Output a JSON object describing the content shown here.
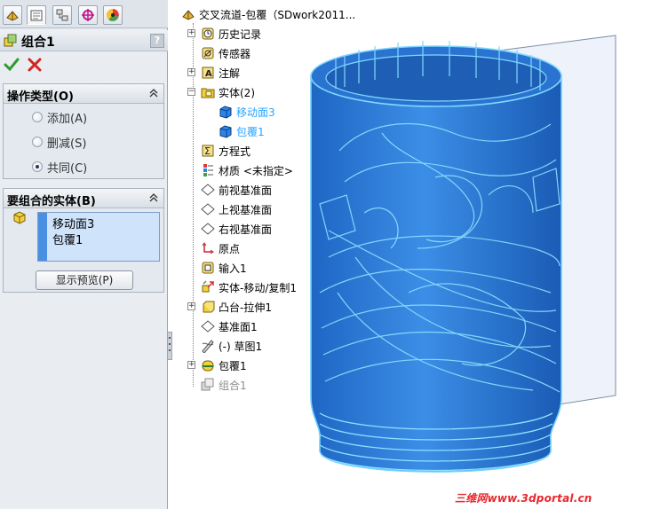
{
  "property_manager": {
    "tabs": [
      "feature-manager-icon",
      "property-manager-icon",
      "configuration-manager-icon",
      "dimxpert-icon",
      "display-manager-icon"
    ],
    "title": "组合1",
    "help_label": "?",
    "operation_section": {
      "title": "操作类型(O)",
      "options": [
        {
          "label": "添加(A)",
          "checked": false
        },
        {
          "label": "删减(S)",
          "checked": false
        },
        {
          "label": "共同(C)",
          "checked": true
        }
      ]
    },
    "bodies_section": {
      "title": "要组合的实体(B)",
      "bodies": [
        "移动面3",
        "包覆1"
      ],
      "preview_button": "显示预览(P)"
    }
  },
  "feature_tree": {
    "root": "交叉流道-包覆（SDwork2011...",
    "items": [
      {
        "label": "历史记录",
        "icon": "history-icon",
        "expander": "+"
      },
      {
        "label": "传感器",
        "icon": "sensor-icon",
        "expander": ""
      },
      {
        "label": "注解",
        "icon": "annotation-icon",
        "expander": "+"
      },
      {
        "label": "实体(2)",
        "icon": "solid-bodies-folder-icon",
        "expander": "−"
      },
      {
        "label": "移动面3",
        "icon": "body-icon",
        "expander": "",
        "child": true,
        "highlight": true
      },
      {
        "label": "包覆1",
        "icon": "body-icon",
        "expander": "",
        "child": true,
        "highlight": true
      },
      {
        "label": "方程式",
        "icon": "equation-icon",
        "expander": ""
      },
      {
        "label": "材质 <未指定>",
        "icon": "material-icon",
        "expander": ""
      },
      {
        "label": "前视基准面",
        "icon": "plane-icon",
        "expander": ""
      },
      {
        "label": "上视基准面",
        "icon": "plane-icon",
        "expander": ""
      },
      {
        "label": "右视基准面",
        "icon": "plane-icon",
        "expander": ""
      },
      {
        "label": "原点",
        "icon": "origin-icon",
        "expander": ""
      },
      {
        "label": "输入1",
        "icon": "import-icon",
        "expander": ""
      },
      {
        "label": "实体-移动/复制1",
        "icon": "move-copy-icon",
        "expander": ""
      },
      {
        "label": "凸台-拉伸1",
        "icon": "extrude-icon",
        "expander": "+"
      },
      {
        "label": "基准面1",
        "icon": "plane-icon",
        "expander": ""
      },
      {
        "label": "(-) 草图1",
        "icon": "sketch-icon",
        "expander": ""
      },
      {
        "label": "包覆1",
        "icon": "wrap-icon",
        "expander": "+"
      },
      {
        "label": "组合1",
        "icon": "combine-icon",
        "expander": "",
        "grayed": true
      }
    ]
  },
  "watermark": "三维网www.3dportal.cn",
  "colors": {
    "body_fill": "#2f7fd8",
    "edge": "#6fd0ff",
    "highlight_text": "#27a5ff",
    "panel_bg": "#e9edf2"
  }
}
